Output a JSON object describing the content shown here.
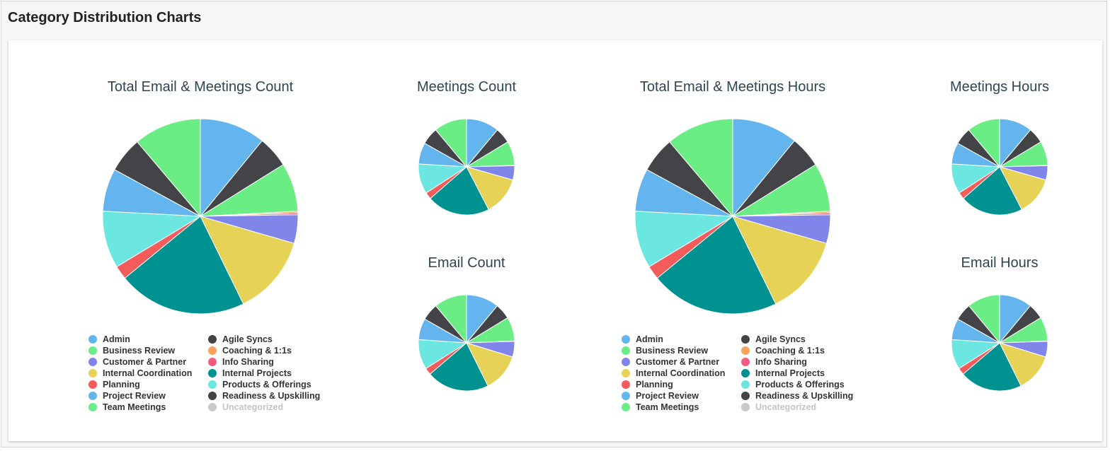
{
  "page": {
    "title": "Category Distribution Charts"
  },
  "colors": {
    "Admin": "#64b5ed",
    "Agile Syncs": "#434348",
    "Business Review": "#6bed85",
    "Coaching & 1:1s": "#f7a35c",
    "Customer & Partner": "#8085e9",
    "Info Sharing": "#f15c80",
    "Internal Coordination": "#e6d257",
    "Internal Projects": "#009291",
    "Planning": "#f45b5b",
    "Products & Offerings": "#6be6e1",
    "Project Review": "#64b5ed",
    "Readiness & Upskilling": "#434348",
    "Team Meetings": "#6bed85",
    "Uncategorized": "#c9c9c9"
  },
  "legend": [
    {
      "label": "Admin",
      "active": true
    },
    {
      "label": "Agile Syncs",
      "active": true
    },
    {
      "label": "Business Review",
      "active": true
    },
    {
      "label": "Coaching & 1:1s",
      "active": true
    },
    {
      "label": "Customer & Partner",
      "active": true
    },
    {
      "label": "Info Sharing",
      "active": true
    },
    {
      "label": "Internal Coordination",
      "active": true
    },
    {
      "label": "Internal Projects",
      "active": true
    },
    {
      "label": "Planning",
      "active": true
    },
    {
      "label": "Products & Offerings",
      "active": true
    },
    {
      "label": "Project Review",
      "active": true
    },
    {
      "label": "Readiness & Upskilling",
      "active": true
    },
    {
      "label": "Team Meetings",
      "active": true
    },
    {
      "label": "Uncategorized",
      "active": false
    }
  ],
  "chart_data": [
    {
      "type": "pie",
      "title": "Total Email & Meetings Count",
      "slices": [
        {
          "label": "Admin",
          "value": 11.5
        },
        {
          "label": "Agile Syncs",
          "value": 5.5
        },
        {
          "label": "Business Review",
          "value": 8.5
        },
        {
          "label": "Coaching & 1:1s",
          "value": 0.3
        },
        {
          "label": "Info Sharing",
          "value": 0.3
        },
        {
          "label": "Customer & Partner",
          "value": 5.0
        },
        {
          "label": "Internal Coordination",
          "value": 14.0
        },
        {
          "label": "Internal Projects",
          "value": 22.5
        },
        {
          "label": "Planning",
          "value": 2.4
        },
        {
          "label": "Products & Offerings",
          "value": 10.0
        },
        {
          "label": "Project Review",
          "value": 7.5
        },
        {
          "label": "Readiness & Upskilling",
          "value": 6.2
        },
        {
          "label": "Team Meetings",
          "value": 11.8
        }
      ]
    },
    {
      "type": "pie",
      "title": "Meetings Count",
      "slices": [
        {
          "label": "Admin",
          "value": 11.5
        },
        {
          "label": "Agile Syncs",
          "value": 5.5
        },
        {
          "label": "Business Review",
          "value": 8.5
        },
        {
          "label": "Coaching & 1:1s",
          "value": 0.1
        },
        {
          "label": "Customer & Partner",
          "value": 5.0
        },
        {
          "label": "Internal Coordination",
          "value": 13.5
        },
        {
          "label": "Internal Projects",
          "value": 22.0
        },
        {
          "label": "Planning",
          "value": 2.4
        },
        {
          "label": "Products & Offerings",
          "value": 10.5
        },
        {
          "label": "Project Review",
          "value": 7.5
        },
        {
          "label": "Readiness & Upskilling",
          "value": 6.0
        },
        {
          "label": "Team Meetings",
          "value": 11.5
        }
      ]
    },
    {
      "type": "pie",
      "title": "Email Count",
      "slices": [
        {
          "label": "Admin",
          "value": 11.5
        },
        {
          "label": "Agile Syncs",
          "value": 5.5
        },
        {
          "label": "Business Review",
          "value": 8.5
        },
        {
          "label": "Coaching & 1:1s",
          "value": 0.1
        },
        {
          "label": "Customer & Partner",
          "value": 5.5
        },
        {
          "label": "Internal Coordination",
          "value": 13.5
        },
        {
          "label": "Internal Projects",
          "value": 22.0
        },
        {
          "label": "Planning",
          "value": 2.4
        },
        {
          "label": "Products & Offerings",
          "value": 10.5
        },
        {
          "label": "Project Review",
          "value": 7.5
        },
        {
          "label": "Readiness & Upskilling",
          "value": 6.0
        },
        {
          "label": "Team Meetings",
          "value": 11.5
        }
      ]
    },
    {
      "type": "pie",
      "title": "Total Email & Meetings Hours",
      "slices": [
        {
          "label": "Admin",
          "value": 11.5
        },
        {
          "label": "Agile Syncs",
          "value": 5.5
        },
        {
          "label": "Business Review",
          "value": 8.5
        },
        {
          "label": "Coaching & 1:1s",
          "value": 0.3
        },
        {
          "label": "Info Sharing",
          "value": 0.3
        },
        {
          "label": "Customer & Partner",
          "value": 5.0
        },
        {
          "label": "Internal Coordination",
          "value": 14.0
        },
        {
          "label": "Internal Projects",
          "value": 22.5
        },
        {
          "label": "Planning",
          "value": 2.4
        },
        {
          "label": "Products & Offerings",
          "value": 10.0
        },
        {
          "label": "Project Review",
          "value": 7.5
        },
        {
          "label": "Readiness & Upskilling",
          "value": 6.2
        },
        {
          "label": "Team Meetings",
          "value": 11.8
        }
      ]
    },
    {
      "type": "pie",
      "title": "Meetings Hours",
      "slices": [
        {
          "label": "Admin",
          "value": 11.5
        },
        {
          "label": "Agile Syncs",
          "value": 5.5
        },
        {
          "label": "Business Review",
          "value": 8.5
        },
        {
          "label": "Coaching & 1:1s",
          "value": 0.1
        },
        {
          "label": "Customer & Partner",
          "value": 5.0
        },
        {
          "label": "Internal Coordination",
          "value": 13.5
        },
        {
          "label": "Internal Projects",
          "value": 22.0
        },
        {
          "label": "Planning",
          "value": 2.4
        },
        {
          "label": "Products & Offerings",
          "value": 10.5
        },
        {
          "label": "Project Review",
          "value": 7.5
        },
        {
          "label": "Readiness & Upskilling",
          "value": 6.0
        },
        {
          "label": "Team Meetings",
          "value": 11.5
        }
      ]
    },
    {
      "type": "pie",
      "title": "Email Hours",
      "slices": [
        {
          "label": "Admin",
          "value": 11.5
        },
        {
          "label": "Agile Syncs",
          "value": 5.5
        },
        {
          "label": "Business Review",
          "value": 8.5
        },
        {
          "label": "Coaching & 1:1s",
          "value": 0.1
        },
        {
          "label": "Customer & Partner",
          "value": 5.5
        },
        {
          "label": "Internal Coordination",
          "value": 13.5
        },
        {
          "label": "Internal Projects",
          "value": 22.0
        },
        {
          "label": "Planning",
          "value": 2.4
        },
        {
          "label": "Products & Offerings",
          "value": 10.5
        },
        {
          "label": "Project Review",
          "value": 7.5
        },
        {
          "label": "Readiness & Upskilling",
          "value": 6.0
        },
        {
          "label": "Team Meetings",
          "value": 11.5
        }
      ]
    }
  ]
}
